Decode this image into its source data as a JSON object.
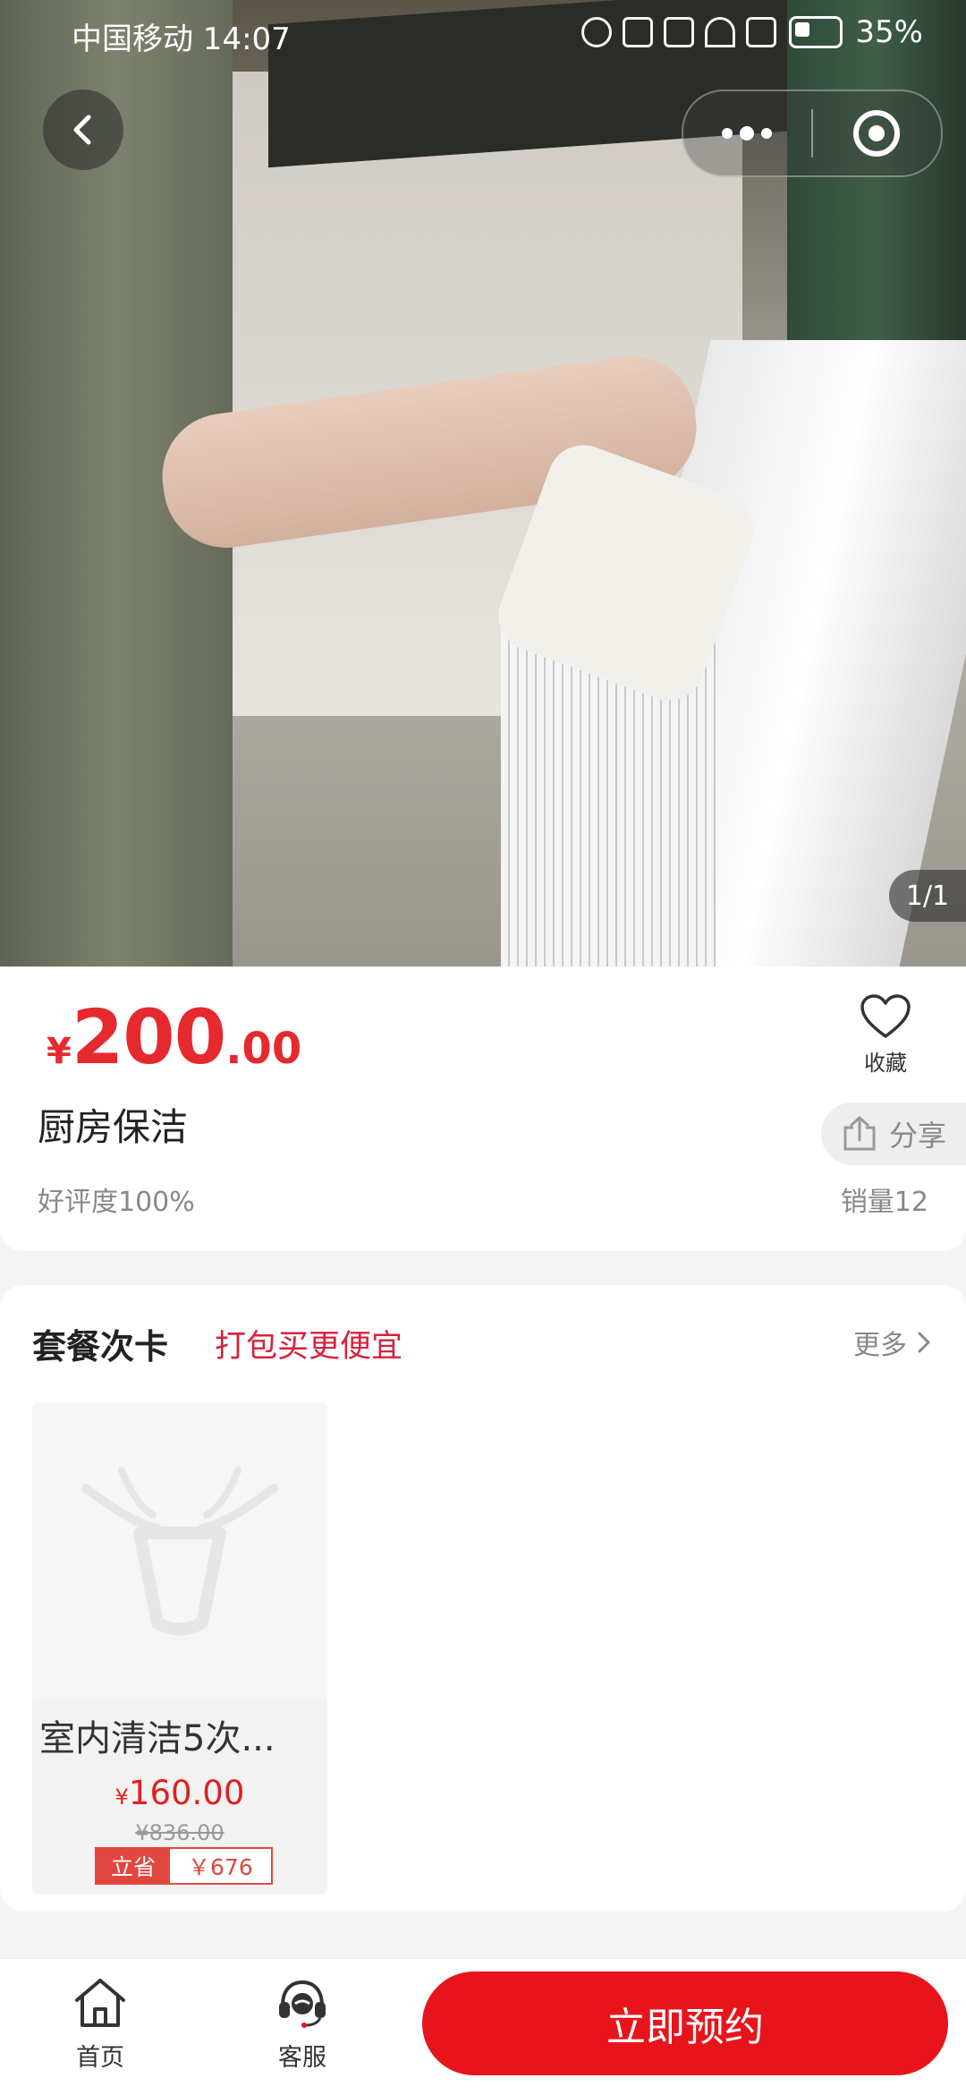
{
  "status_bar": {
    "carrier_time": "中国移动 14:07",
    "battery": "35%"
  },
  "hero": {
    "counter": "1/1"
  },
  "product": {
    "currency": "¥",
    "price_int": "200",
    "price_dec": ".00",
    "name": "厨房保洁",
    "rating": "好评度100%",
    "sales": "销量12",
    "favorite_label": "收藏",
    "share_label": "分享"
  },
  "package_section": {
    "title": "套餐次卡",
    "subtitle": "打包买更便宜",
    "more_label": "更多",
    "items": [
      {
        "name": "室内清洁5次...",
        "currency": "¥",
        "price": "160.00",
        "original_price": "¥836.00",
        "save_tag": "立省",
        "save_amount": "￥676"
      }
    ]
  },
  "bottom_bar": {
    "home_label": "首页",
    "service_label": "客服",
    "book_label": "立即预约"
  },
  "colors": {
    "accent": "#e8141c",
    "price": "#e6292f",
    "promo": "#d6213d"
  },
  "icons": [
    "back-icon",
    "more-dots-icon",
    "target-icon",
    "heart-icon",
    "share-icon",
    "chevron-right-icon",
    "home-icon",
    "headset-icon"
  ]
}
